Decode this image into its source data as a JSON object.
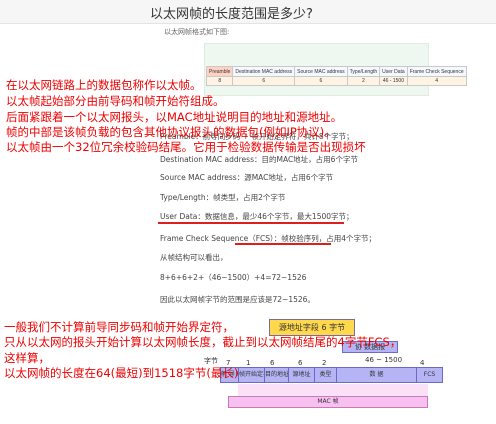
{
  "title": "以太网帧的长度范围是多少?",
  "subtitle": "以太网帧格式如下图:",
  "frame_table": {
    "headers": [
      "Preamble",
      "Destination MAC address",
      "Source MAC address",
      "Type/Length",
      "User Data",
      "Frame Check Sequence"
    ],
    "values": [
      "8",
      "6",
      "6",
      "2",
      "46 - 1500",
      "4"
    ]
  },
  "desc_lines": [
    "Preamble：前导同步码 + 帧开始定界符，共计8个字节；",
    "Destination MAC address：目的MAC地址，占用6个字节",
    "Source MAC address：源MAC地址，占用6个字节",
    "Type/Length：帧类型，占用2个字节",
    "User Data：数据信息，最少46个字节，最大1500字节；",
    "Frame Check Sequence（FCS）：帧校验序列，占用4个字节；",
    "从帧结构可以看出，",
    "8+6+6+2+（46~1500）+4=72~1526",
    "因此以太网帧字节的范围是应该是72~1526。"
  ],
  "red_notes_top": [
    "在以太网链路上的数据包称作以太帧。",
    "以太帧起始部分由前导码和帧开始符组成。",
    "后面紧跟着一个以太网报头，以MAC地址说明目的地址和源地址。",
    "帧的中部是该帧负载的包含其他协议报头的数据包(例如IP协议)。",
    "以太帧由一个32位冗余校验码结尾。它用于检验数据传输是否出现损坏"
  ],
  "red_notes_bottom": [
    "一般我们不计算前导同步码和帧开始界定符，",
    "只从以太网的报头开始计算以太网帧长度，截止到以太网帧结尾的4字节FCS，",
    "这样算，",
    "以太网帧的长度在64(最短)到1518字节(最长)"
  ],
  "diagram": {
    "callout": "源地址字段 6 字节",
    "proto_label": "协 数据报",
    "range_label": "46 ~ 1500",
    "bytes_label": "字节",
    "byte_counts": [
      "7",
      "1",
      "6",
      "6",
      "2",
      "4"
    ],
    "cells": [
      "前 导 码",
      "帧开始定界符",
      "目的地址",
      "源地址",
      "类型",
      "数    据",
      "FCS"
    ],
    "mac_label": "MAC 帧"
  }
}
